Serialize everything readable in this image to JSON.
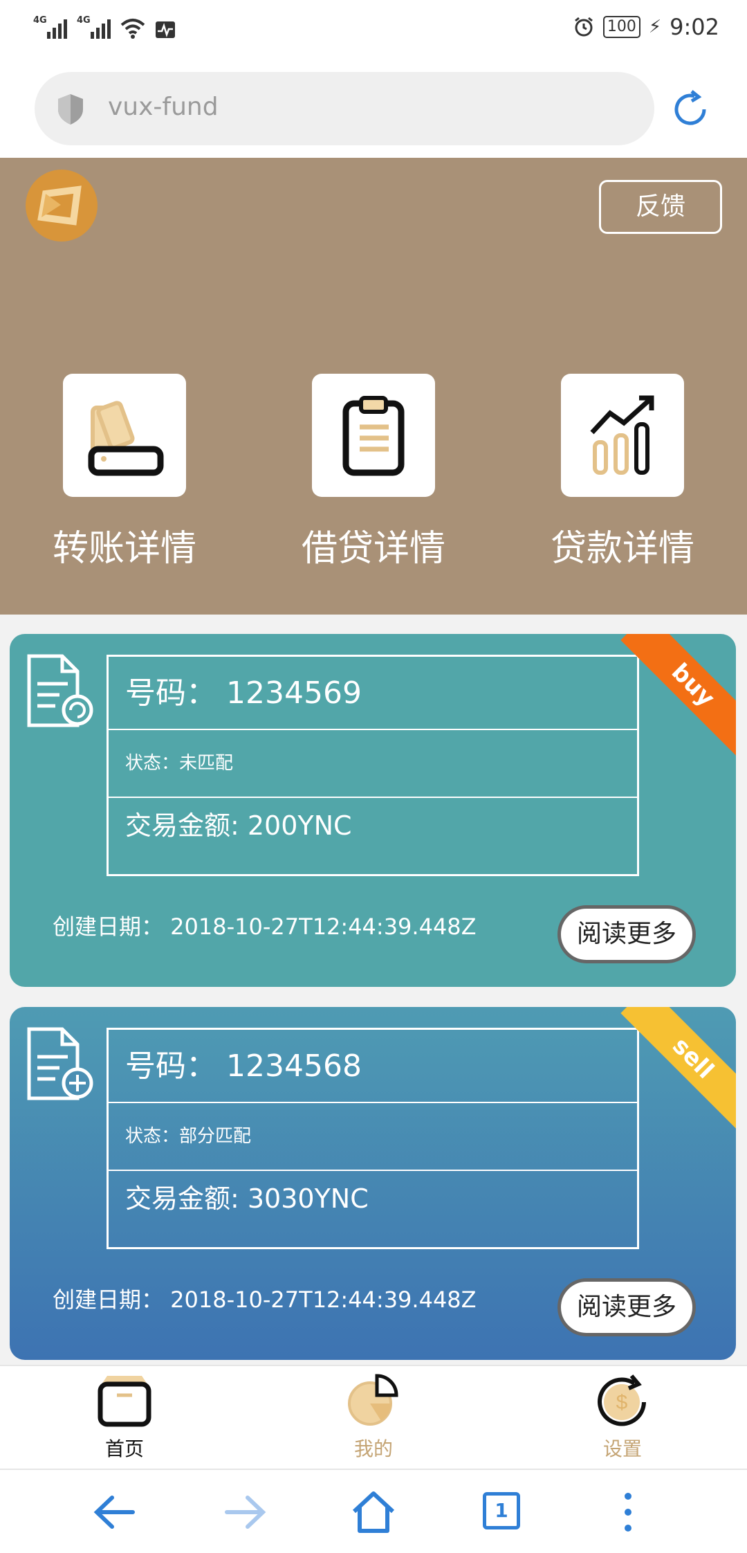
{
  "status_bar": {
    "signal1": "4G",
    "signal2": "4G",
    "battery": "100",
    "time": "9:02"
  },
  "url_bar": {
    "url": "vux-fund"
  },
  "header": {
    "feedback_label": "反馈"
  },
  "features": [
    {
      "label": "转账详情",
      "icon": "wallet-icon"
    },
    {
      "label": "借贷详情",
      "icon": "clipboard-icon"
    },
    {
      "label": "贷款详情",
      "icon": "bar-chart-icon"
    }
  ],
  "orders": [
    {
      "number": "号码： 1234569",
      "status": "状态：未匹配",
      "amount": "交易金额: 200YNC",
      "created": "创建日期： 2018-10-27T12:44:39.448Z",
      "tag": "buy",
      "tag_color": "#f36f14",
      "read_more": "阅读更多"
    },
    {
      "number": "号码： 1234568",
      "status": "状态：部分匹配",
      "amount": "交易金额: 3030YNC",
      "created": "创建日期： 2018-10-27T12:44:39.448Z",
      "tag": "sell",
      "tag_color": "#f6c133",
      "read_more": "阅读更多"
    }
  ],
  "tab_bar": [
    {
      "label": "首页",
      "icon": "box-icon",
      "active": true
    },
    {
      "label": "我的",
      "icon": "pie-chart-icon",
      "active": false
    },
    {
      "label": "设置",
      "icon": "dollar-refresh-icon",
      "active": false
    }
  ],
  "nav_bar": {
    "tab_count": "1"
  },
  "colors": {
    "hero_bg": "#a99177",
    "card1_bg": "#52a6a9",
    "card2_bg": "#3d73b2",
    "accent_gold": "#e6c38a"
  }
}
